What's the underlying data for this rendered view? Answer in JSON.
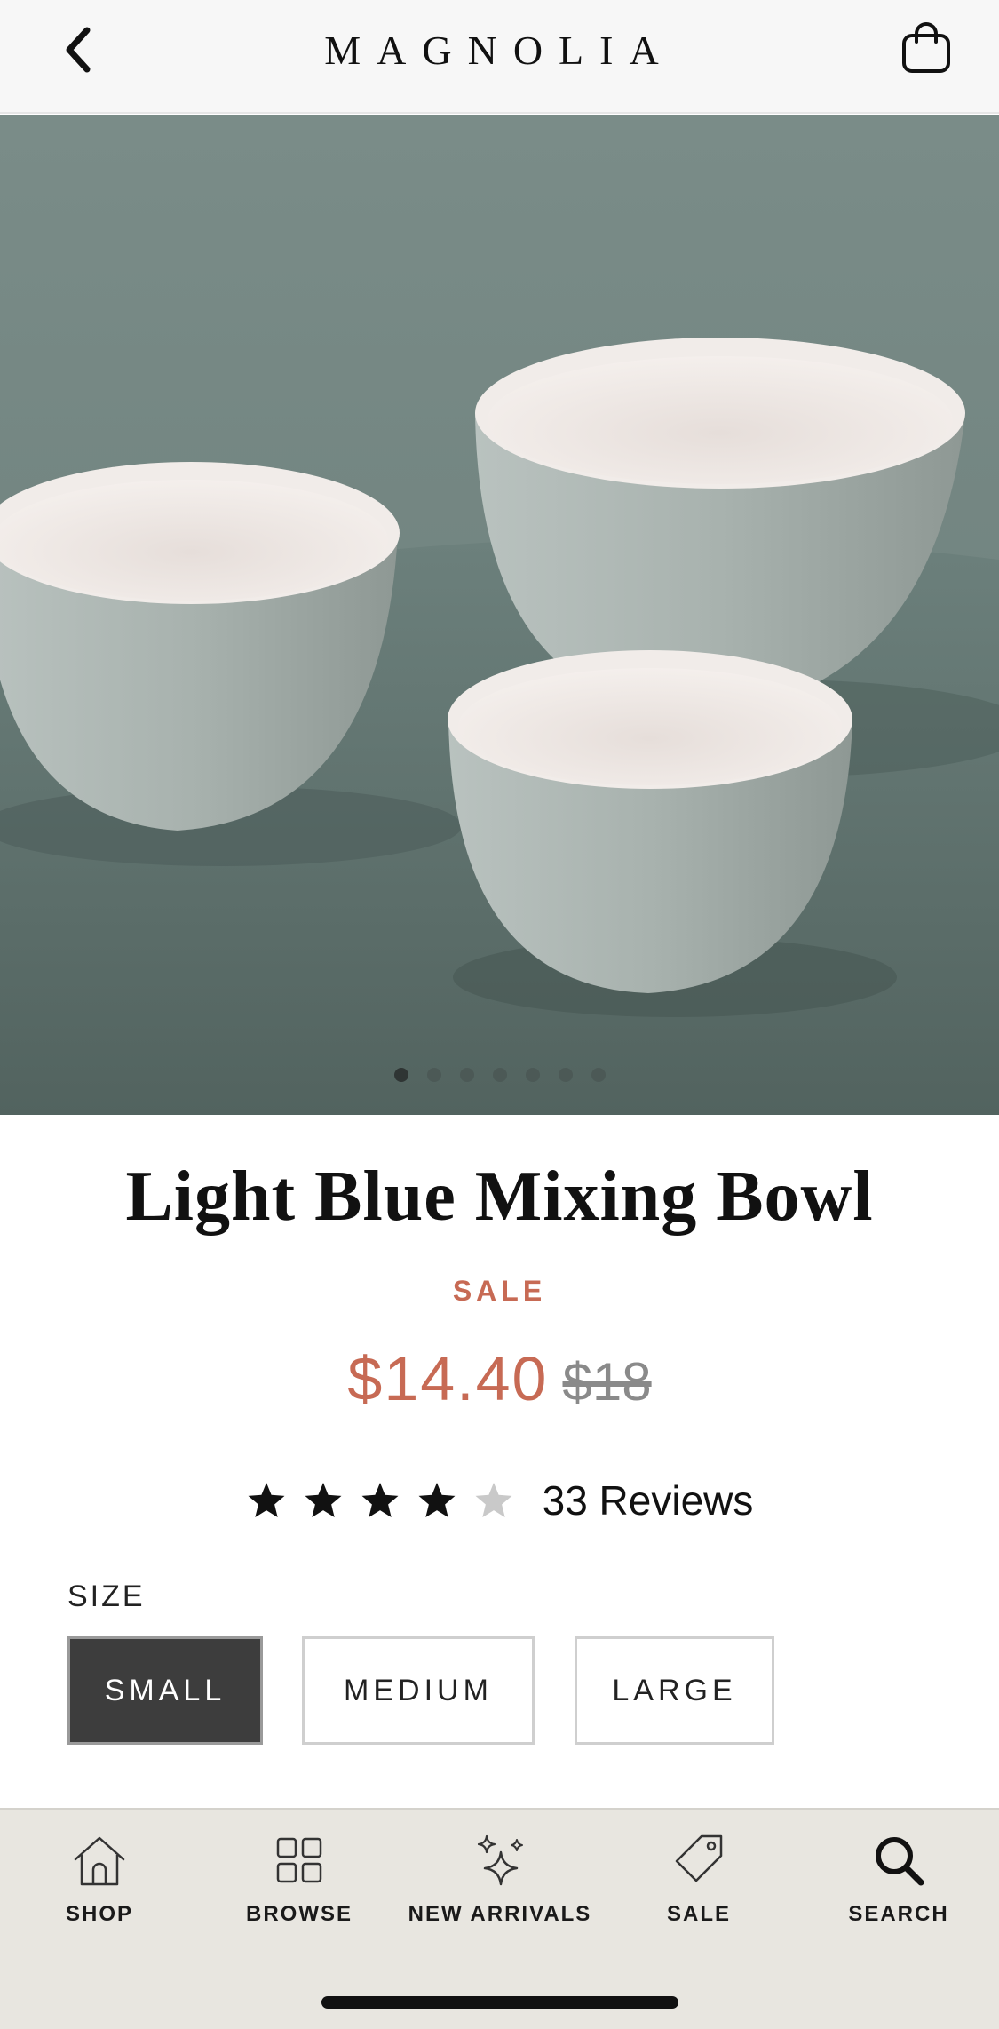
{
  "header": {
    "brand": "MAGNOLIA",
    "back_icon": "chevron-left-icon",
    "cart_icon": "shopping-bag-icon"
  },
  "gallery": {
    "image_count": 7,
    "active_index": 0
  },
  "product": {
    "title": "Light Blue Mixing Bowl",
    "sale_label": "SALE",
    "sale_price": "$14.40",
    "original_price": "$18",
    "rating": 4,
    "rating_max": 5,
    "reviews_label": "33 Reviews",
    "size_label": "SIZE",
    "sizes": [
      {
        "label": "SMALL",
        "selected": true
      },
      {
        "label": "MEDIUM",
        "selected": false
      },
      {
        "label": "LARGE",
        "selected": false
      }
    ]
  },
  "bottom_nav": {
    "items": [
      {
        "label": "SHOP",
        "icon": "home-icon"
      },
      {
        "label": "BROWSE",
        "icon": "grid-icon"
      },
      {
        "label": "NEW ARRIVALS",
        "icon": "sparkle-icon"
      },
      {
        "label": "SALE",
        "icon": "tag-icon"
      },
      {
        "label": "SEARCH",
        "icon": "search-icon"
      }
    ]
  },
  "colors": {
    "accent_sale": "#c76a54",
    "selected_bg": "#3d3d3d",
    "nav_bg": "#e8e6e0"
  }
}
